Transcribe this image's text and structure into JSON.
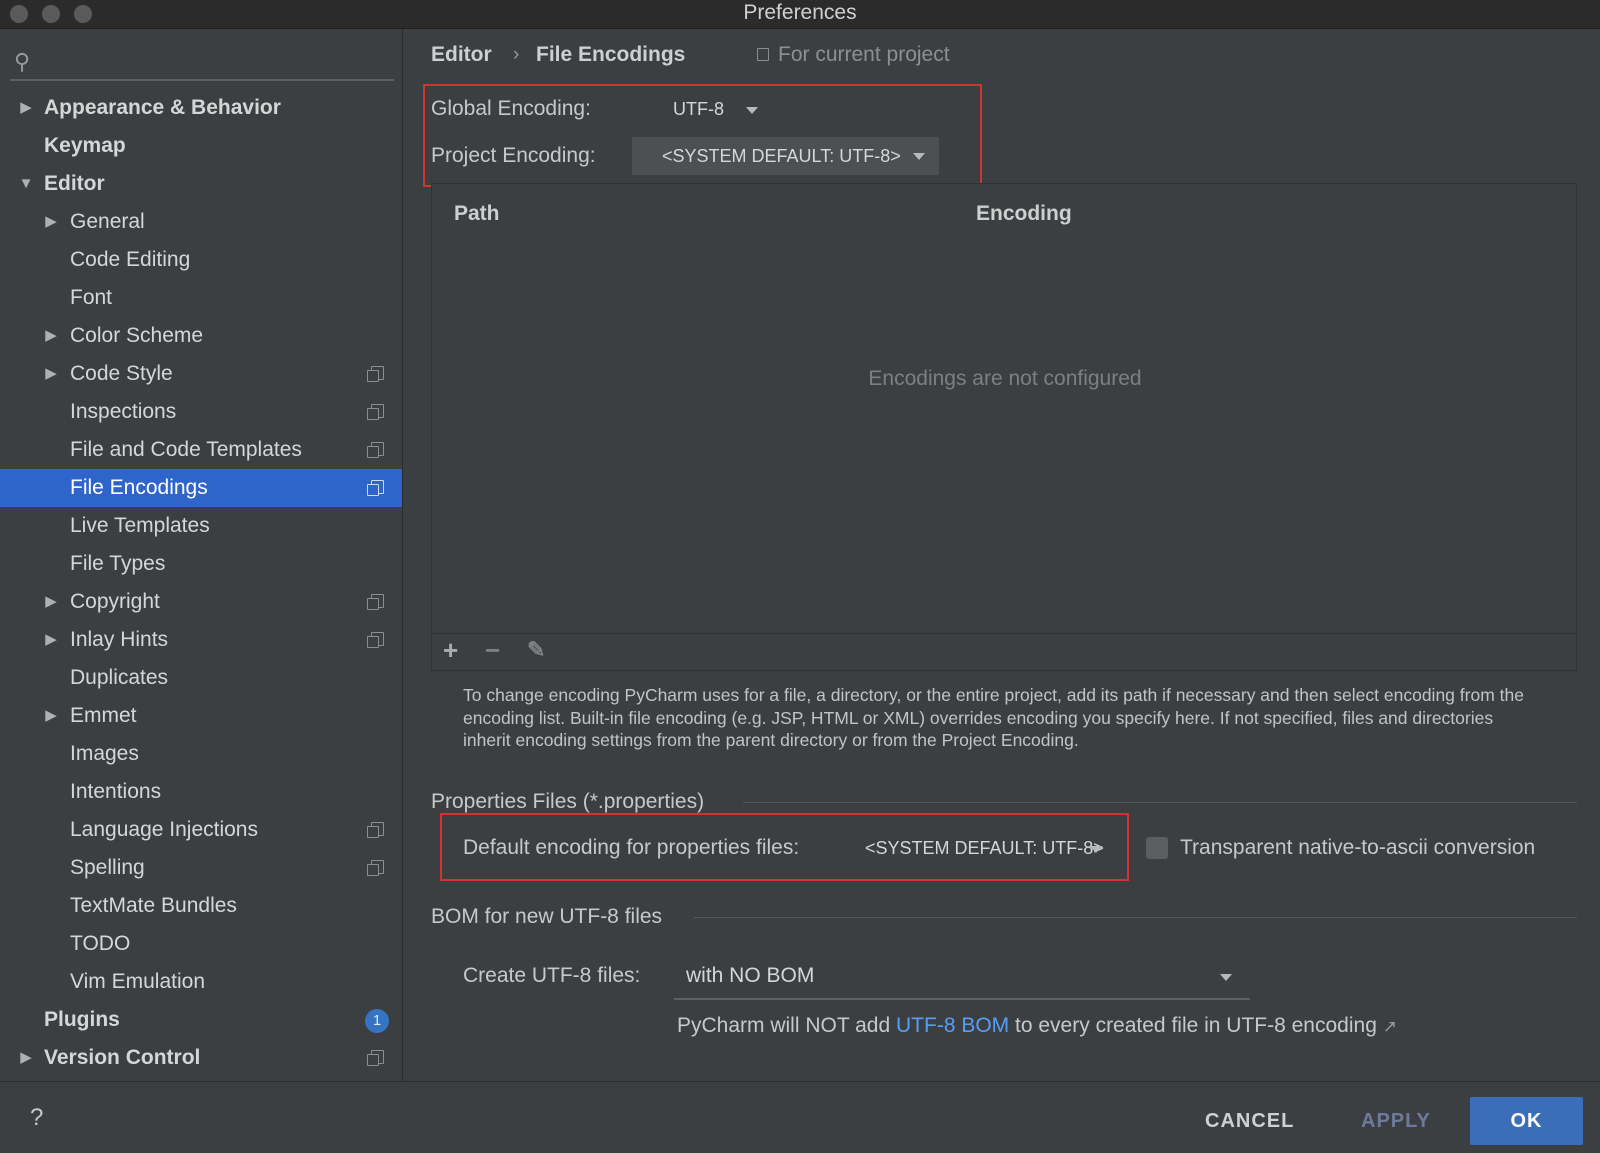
{
  "window": {
    "title": "Preferences"
  },
  "search": {
    "placeholder": ""
  },
  "sidebar": {
    "items": [
      {
        "label": "Appearance & Behavior"
      },
      {
        "label": "Keymap"
      },
      {
        "label": "Editor"
      },
      {
        "label": "General"
      },
      {
        "label": "Code Editing"
      },
      {
        "label": "Font"
      },
      {
        "label": "Color Scheme"
      },
      {
        "label": "Code Style"
      },
      {
        "label": "Inspections"
      },
      {
        "label": "File and Code Templates"
      },
      {
        "label": "File Encodings"
      },
      {
        "label": "Live Templates"
      },
      {
        "label": "File Types"
      },
      {
        "label": "Copyright"
      },
      {
        "label": "Inlay Hints"
      },
      {
        "label": "Duplicates"
      },
      {
        "label": "Emmet"
      },
      {
        "label": "Images"
      },
      {
        "label": "Intentions"
      },
      {
        "label": "Language Injections"
      },
      {
        "label": "Spelling"
      },
      {
        "label": "TextMate Bundles"
      },
      {
        "label": "TODO"
      },
      {
        "label": "Vim Emulation"
      },
      {
        "label": "Plugins",
        "badge": "1"
      },
      {
        "label": "Version Control"
      }
    ]
  },
  "breadcrumb": {
    "parent": "Editor",
    "separator": "›",
    "current": "File Encodings",
    "scope": "For current project"
  },
  "encoding": {
    "global_label": "Global Encoding:",
    "global_value": "UTF-8",
    "project_label": "Project Encoding:",
    "project_value": "<SYSTEM DEFAULT: UTF-8>"
  },
  "table": {
    "columns": [
      "Path",
      "Encoding"
    ],
    "empty_text": "Encodings are not configured"
  },
  "toolbar": {
    "add": "+",
    "remove": "−",
    "edit": "✎"
  },
  "help_text": "To change encoding PyCharm uses for a file, a directory, or the entire project, add its path if necessary and then select encoding from the encoding list. Built-in file encoding (e.g. JSP, HTML or XML) overrides encoding you specify here. If not specified, files and directories inherit encoding settings from the parent directory or from the Project Encoding.",
  "properties": {
    "section_title": "Properties Files (*.properties)",
    "default_label": "Default encoding for properties files:",
    "default_value": "<SYSTEM DEFAULT: UTF-8>",
    "transparent_label": "Transparent native-to-ascii conversion",
    "transparent_checked": false
  },
  "bom": {
    "section_title": "BOM for new UTF-8 files",
    "create_label": "Create UTF-8 files:",
    "create_value": "with NO BOM",
    "note_prefix": "PyCharm will NOT add",
    "note_link": "UTF-8 BOM",
    "note_suffix": "to every created file in UTF-8 encoding",
    "note_arrow": "↗"
  },
  "footer": {
    "help": "?",
    "cancel": "CANCEL",
    "apply": "APPLY",
    "ok": "OK"
  },
  "colors": {
    "accent": "#2f65ca",
    "highlight_box": "#d0342c",
    "link": "#589df6",
    "ok_button": "#3a6fb8"
  }
}
